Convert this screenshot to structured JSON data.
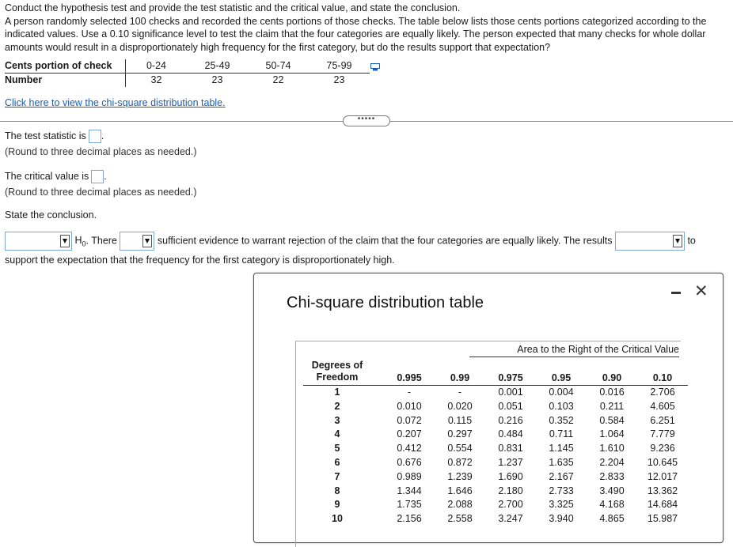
{
  "question": {
    "line1": "Conduct the hypothesis test and provide the test statistic and the critical value, and state the conclusion.",
    "body": "A person randomly selected 100 checks and recorded the cents portions of those checks. The table below lists those cents portions categorized according to the indicated values. Use a 0.10 significance level to test the claim that the four categories are equally likely. The person expected that many checks for whole dollar amounts would result in a disproportionately high frequency for the first category, but do the results support that expectation?"
  },
  "data_table": {
    "row1_header": "Cents portion of check",
    "row2_header": "Number",
    "categories": [
      "0-24",
      "25-49",
      "50-74",
      "75-99"
    ],
    "numbers": [
      "32",
      "23",
      "22",
      "23"
    ]
  },
  "link_text": "Click here to view the chi-square distribution table.",
  "more_button": "•••••",
  "test_statistic": {
    "label": "The test statistic is",
    "value": "",
    "note": "(Round to three decimal places as needed.)"
  },
  "critical_value": {
    "label": "The critical value is",
    "value": "",
    "note": "(Round to three decimal places as needed.)"
  },
  "state_conclusion": "State the conclusion.",
  "conclusion": {
    "dropdown1_value": "",
    "h0": "H",
    "h0_sub": "0",
    "there": ". There",
    "dropdown2_value": "",
    "mid_text": "sufficient evidence to warrant rejection of the claim that the four categories are equally likely. The results",
    "dropdown3_value": "",
    "to": "to",
    "line2": "support the expectation that the frequency for the first category is disproportionately high."
  },
  "popup": {
    "title": "Chi-square distribution table",
    "close_glyph": "✕",
    "area_header": "Area to the Right of the Critical Value",
    "df_header_line1": "Degrees of",
    "df_header_line2": "Freedom",
    "alphas": [
      "0.995",
      "0.99",
      "0.975",
      "0.95",
      "0.90",
      "0.10"
    ],
    "rows": [
      {
        "df": "1",
        "vals": [
          "-",
          "-",
          "0.001",
          "0.004",
          "0.016",
          "2.706"
        ]
      },
      {
        "df": "2",
        "vals": [
          "0.010",
          "0.020",
          "0.051",
          "0.103",
          "0.211",
          "4.605"
        ]
      },
      {
        "df": "3",
        "vals": [
          "0.072",
          "0.115",
          "0.216",
          "0.352",
          "0.584",
          "6.251"
        ]
      },
      {
        "df": "4",
        "vals": [
          "0.207",
          "0.297",
          "0.484",
          "0.711",
          "1.064",
          "7.779"
        ]
      },
      {
        "df": "5",
        "vals": [
          "0.412",
          "0.554",
          "0.831",
          "1.145",
          "1.610",
          "9.236"
        ]
      },
      {
        "df": "6",
        "vals": [
          "0.676",
          "0.872",
          "1.237",
          "1.635",
          "2.204",
          "10.645"
        ]
      },
      {
        "df": "7",
        "vals": [
          "0.989",
          "1.239",
          "1.690",
          "2.167",
          "2.833",
          "12.017"
        ]
      },
      {
        "df": "8",
        "vals": [
          "1.344",
          "1.646",
          "2.180",
          "2.733",
          "3.490",
          "13.362"
        ]
      },
      {
        "df": "9",
        "vals": [
          "1.735",
          "2.088",
          "2.700",
          "3.325",
          "4.168",
          "14.684"
        ]
      },
      {
        "df": "10",
        "vals": [
          "2.156",
          "2.558",
          "3.247",
          "3.940",
          "4.865",
          "15.987"
        ]
      }
    ]
  },
  "colors": {
    "link": "#1a5fb4",
    "input_border": "#7fa7d6"
  }
}
